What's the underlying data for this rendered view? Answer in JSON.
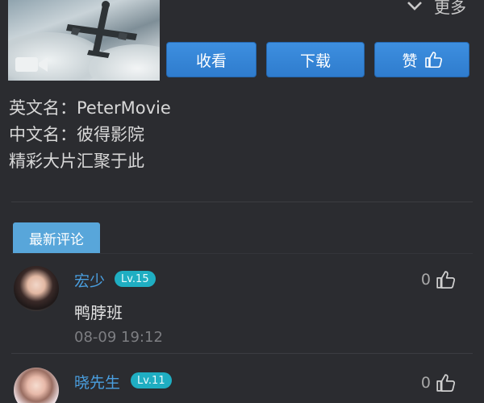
{
  "header": {
    "more_label": "更多"
  },
  "actions": {
    "collect_label": "收看",
    "download_label": "下载",
    "like_label": "赞"
  },
  "info": {
    "english_name": "英文名：PeterMovie",
    "chinese_name": "中文名：彼得影院",
    "slogan": "精彩大片汇聚于此"
  },
  "comments_section": {
    "title": "最新评论",
    "items": [
      {
        "username": "宏少",
        "level": "Lv.15",
        "text": "鸭脖班",
        "time": "08-09 19:12",
        "likes": "0"
      },
      {
        "username": "晓先生",
        "level": "Lv.11",
        "likes": "0"
      }
    ]
  },
  "colors": {
    "background": "#2b2c30",
    "button_blue": "#3d8fe0",
    "username_blue": "#4a9fe0",
    "level_teal": "#1faec2",
    "tag_blue": "#58a6da"
  }
}
